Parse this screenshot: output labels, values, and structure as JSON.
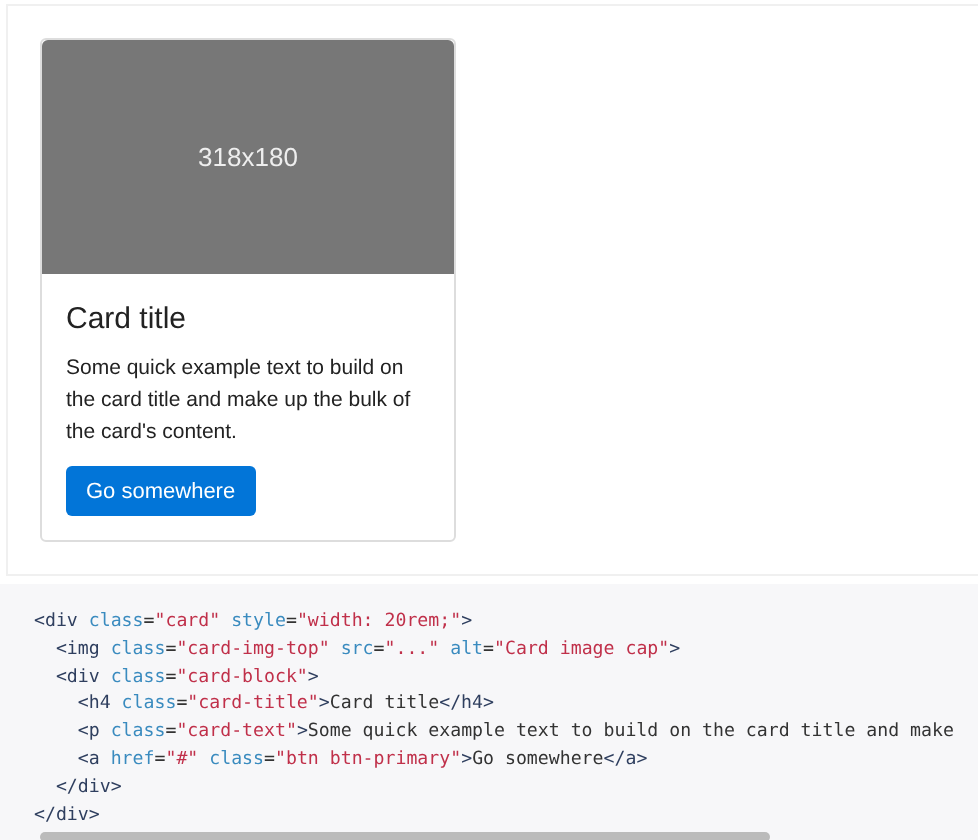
{
  "example": {
    "card": {
      "image": {
        "label": "318x180"
      },
      "title": "Card title",
      "text": "Some quick example text to build on the card title and make up the bulk of the card's content.",
      "button": "Go somewhere"
    }
  },
  "code": {
    "lines": [
      [
        {
          "kind": "tag",
          "text": "<div"
        },
        {
          "kind": "attr",
          "text": " class"
        },
        {
          "kind": "plain",
          "text": "="
        },
        {
          "kind": "string",
          "text": "\"card\""
        },
        {
          "kind": "attr",
          "text": " style"
        },
        {
          "kind": "plain",
          "text": "="
        },
        {
          "kind": "string",
          "text": "\"width: 20rem;\""
        },
        {
          "kind": "tag",
          "text": ">"
        }
      ],
      [
        {
          "kind": "tag",
          "text": "  <img"
        },
        {
          "kind": "attr",
          "text": " class"
        },
        {
          "kind": "plain",
          "text": "="
        },
        {
          "kind": "string",
          "text": "\"card-img-top\""
        },
        {
          "kind": "attr",
          "text": " src"
        },
        {
          "kind": "plain",
          "text": "="
        },
        {
          "kind": "string",
          "text": "\"...\""
        },
        {
          "kind": "attr",
          "text": " alt"
        },
        {
          "kind": "plain",
          "text": "="
        },
        {
          "kind": "string",
          "text": "\"Card image cap\""
        },
        {
          "kind": "tag",
          "text": ">"
        }
      ],
      [
        {
          "kind": "tag",
          "text": "  <div"
        },
        {
          "kind": "attr",
          "text": " class"
        },
        {
          "kind": "plain",
          "text": "="
        },
        {
          "kind": "string",
          "text": "\"card-block\""
        },
        {
          "kind": "tag",
          "text": ">"
        }
      ],
      [
        {
          "kind": "tag",
          "text": "    <h4"
        },
        {
          "kind": "attr",
          "text": " class"
        },
        {
          "kind": "plain",
          "text": "="
        },
        {
          "kind": "string",
          "text": "\"card-title\""
        },
        {
          "kind": "tag",
          "text": ">"
        },
        {
          "kind": "plain",
          "text": "Card title"
        },
        {
          "kind": "tag",
          "text": "</h4>"
        }
      ],
      [
        {
          "kind": "tag",
          "text": "    <p"
        },
        {
          "kind": "attr",
          "text": " class"
        },
        {
          "kind": "plain",
          "text": "="
        },
        {
          "kind": "string",
          "text": "\"card-text\""
        },
        {
          "kind": "tag",
          "text": ">"
        },
        {
          "kind": "plain",
          "text": "Some quick example text to build on the card title and make"
        }
      ],
      [
        {
          "kind": "tag",
          "text": "    <a"
        },
        {
          "kind": "attr",
          "text": " href"
        },
        {
          "kind": "plain",
          "text": "="
        },
        {
          "kind": "string",
          "text": "\"#\""
        },
        {
          "kind": "attr",
          "text": " class"
        },
        {
          "kind": "plain",
          "text": "="
        },
        {
          "kind": "string",
          "text": "\"btn btn-primary\""
        },
        {
          "kind": "tag",
          "text": ">"
        },
        {
          "kind": "plain",
          "text": "Go somewhere"
        },
        {
          "kind": "tag",
          "text": "</a>"
        }
      ],
      [
        {
          "kind": "tag",
          "text": "  </div>"
        }
      ],
      [
        {
          "kind": "tag",
          "text": "</div>"
        }
      ]
    ]
  }
}
